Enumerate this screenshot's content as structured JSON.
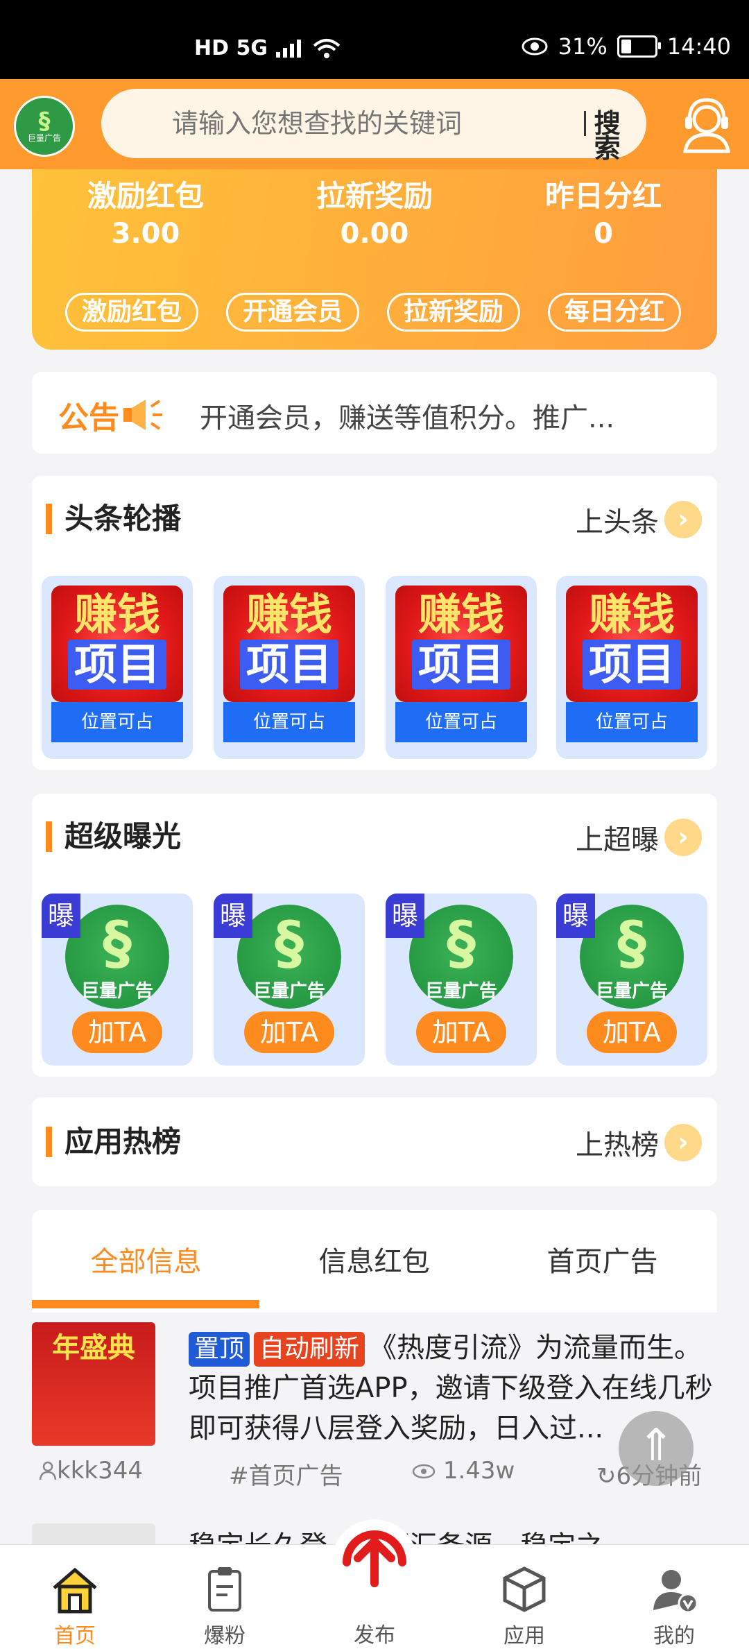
{
  "status_bar": {
    "network": "HD 5G",
    "battery": "31%",
    "battery_level": 0.31,
    "time": "14:40"
  },
  "header": {
    "logo_text": "巨量广告",
    "search_placeholder": "请输入您想查找的关键词",
    "search_button": "搜索"
  },
  "rewards": {
    "stats": [
      {
        "label": "激励红包",
        "value": "3.00"
      },
      {
        "label": "拉新奖励",
        "value": "0.00"
      },
      {
        "label": "昨日分红",
        "value": "0"
      }
    ],
    "buttons": [
      "激励红包",
      "开通会员",
      "拉新奖励",
      "每日分红"
    ]
  },
  "notice": {
    "title": "公告",
    "text": "开通会员，赚送等值积分。推广..."
  },
  "headline": {
    "title": "头条轮播",
    "link": "上头条",
    "items": [
      {
        "line1": "赚钱",
        "line2": "项目",
        "caption": "位置可占"
      },
      {
        "line1": "赚钱",
        "line2": "项目",
        "caption": "位置可占"
      },
      {
        "line1": "赚钱",
        "line2": "项目",
        "caption": "位置可占"
      },
      {
        "line1": "赚钱",
        "line2": "项目",
        "caption": "位置可占"
      }
    ]
  },
  "exposure": {
    "title": "超级曝光",
    "link": "上超曝",
    "items": [
      {
        "badge": "曝",
        "logo_text": "巨量广告",
        "button": "加TA"
      },
      {
        "badge": "曝",
        "logo_text": "巨量广告",
        "button": "加TA"
      },
      {
        "badge": "曝",
        "logo_text": "巨量广告",
        "button": "加TA"
      },
      {
        "badge": "曝",
        "logo_text": "巨量广告",
        "button": "加TA"
      }
    ]
  },
  "hot": {
    "title": "应用热榜",
    "link": "上热榜"
  },
  "tabs": [
    "全部信息",
    "信息红包",
    "首页广告"
  ],
  "feed": [
    {
      "thumb_title": "年盛典",
      "tag_top": "置顶",
      "tag_auto": "自动刷新",
      "text": "《热度引流》为流量而生。项目推广首选APP，邀请下级登入在线几秒即可获得八层登入奖励，日入过...",
      "user": "kkk344",
      "category": "首页广告",
      "views": "1.43w",
      "time": "6分钟前"
    },
    {
      "text": "稳定长久登...简而汇备源，稳定之"
    }
  ],
  "bottom_nav": [
    "首页",
    "爆粉",
    "发布",
    "应用",
    "我的"
  ],
  "colors": {
    "accent": "#ff8a1e",
    "header": "#ff9a2e",
    "blue": "#1f6df5"
  }
}
